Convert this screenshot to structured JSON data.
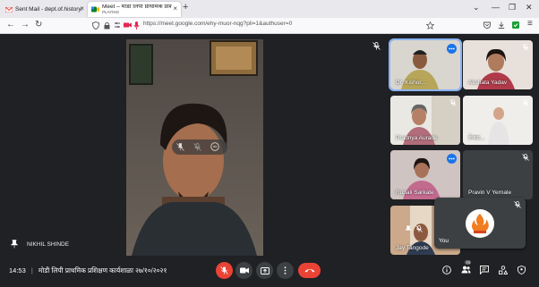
{
  "browser": {
    "tabs": [
      {
        "title": "Sent Mail - dept.of.history.rsmt",
        "active": false
      },
      {
        "title": "Meet – मोडी लिपी प्राथमिक प्रशिक्षण",
        "subtitle": "PLAYING",
        "active": true
      }
    ],
    "new_tab": "+",
    "url": "https://meet.google.com/ehy-muor-nqg?pli=1&authuser=0"
  },
  "meeting": {
    "active_speaker": "NIKHIL SHINDE",
    "participants": [
      {
        "name": "Dr. Kishor..."
      },
      {
        "name": "Akshata Yadav"
      },
      {
        "name": "Pradnya Aurade"
      },
      {
        "name": "तेजस..."
      },
      {
        "name": "Rupali Sarkate"
      },
      {
        "name": "Pravin V Yernale"
      },
      {
        "name": "Jay Tangode"
      }
    ],
    "self_label": "You"
  },
  "bottom_bar": {
    "time": "14:53",
    "separator": "|",
    "meeting_title": "मोडी लिपी प्राथमिक प्रशिक्षण कार्यशाळा २७/१०/२०२१",
    "participants_count": "70"
  },
  "colors": {
    "accent": "#8ab4f8",
    "danger": "#ea4335",
    "background": "#202124",
    "tile": "#3c4043"
  }
}
